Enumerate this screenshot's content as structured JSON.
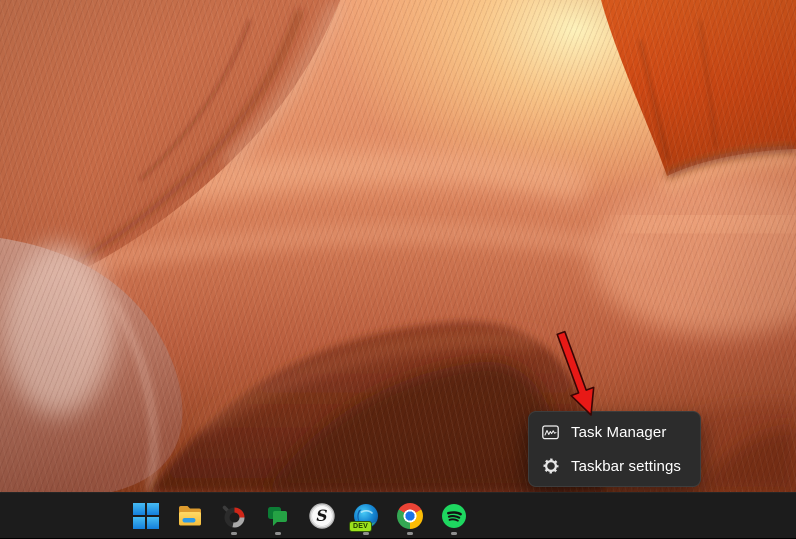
{
  "context_menu": {
    "items": [
      {
        "label": "Task Manager",
        "icon": "task-manager-icon"
      },
      {
        "label": "Taskbar settings",
        "icon": "gear-icon"
      }
    ],
    "background": "#2c2c2c",
    "text_color": "#ffffff"
  },
  "annotation": {
    "type": "arrow",
    "color": "#e81916",
    "points_to": "Task Manager"
  },
  "taskbar": {
    "background": "#1c1c1c",
    "indicator_color": "#8f8f8f",
    "items": [
      {
        "name": "start",
        "running": false
      },
      {
        "name": "file-explorer",
        "running": false
      },
      {
        "name": "ring-chart-app",
        "running": true
      },
      {
        "name": "google-chat",
        "running": true
      },
      {
        "name": "s-app",
        "running": false,
        "letter": "S"
      },
      {
        "name": "edge-dev",
        "running": true,
        "badge": "DEV"
      },
      {
        "name": "chrome",
        "running": true
      },
      {
        "name": "spotify",
        "running": true
      }
    ]
  },
  "wallpaper": {
    "description": "Antelope Canyon sandstone waves with warm glow",
    "palette": {
      "glow": "#fdf2bb",
      "salmon": "#e79a74",
      "dark_column": "#cd4814",
      "valley": "#5e2410",
      "rose": "#c98d7f"
    }
  }
}
